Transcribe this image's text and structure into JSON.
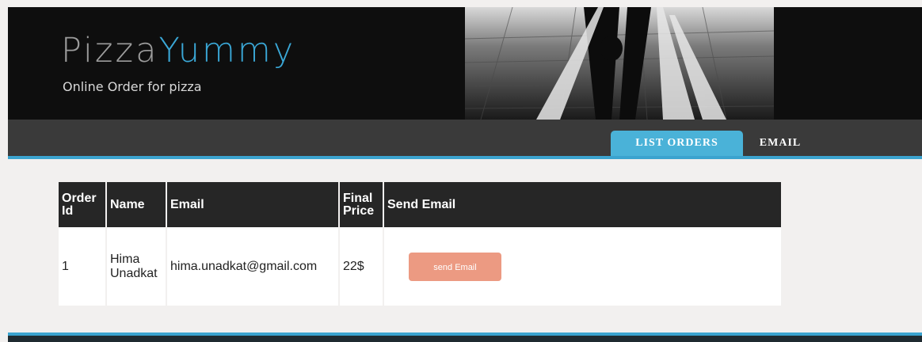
{
  "header": {
    "logo_part1": "Pizza",
    "logo_part2": "Yummy",
    "tagline": "Online Order for pizza"
  },
  "nav": {
    "tabs": [
      {
        "label": "LIST ORDERS",
        "active": true
      },
      {
        "label": "EMAIL",
        "active": false
      }
    ]
  },
  "orders": {
    "columns": [
      "Order Id",
      "Name",
      "Email",
      "Final Price",
      "Send Email"
    ],
    "column_lines": {
      "order_id": [
        "Order",
        "Id"
      ],
      "final_price": [
        "Final",
        "Price"
      ]
    },
    "rows": [
      {
        "order_id": "1",
        "name_lines": [
          "Hima",
          "Unadkat"
        ],
        "email": "hima.unadkat@gmail.com",
        "final_price": "22$",
        "action_label": "send Email"
      }
    ]
  },
  "colors": {
    "accent_blue": "#3ba3cf",
    "button_salmon": "#ec9a82",
    "header_bg": "#0e0e0e",
    "nav_bg": "#3a3a3a"
  }
}
